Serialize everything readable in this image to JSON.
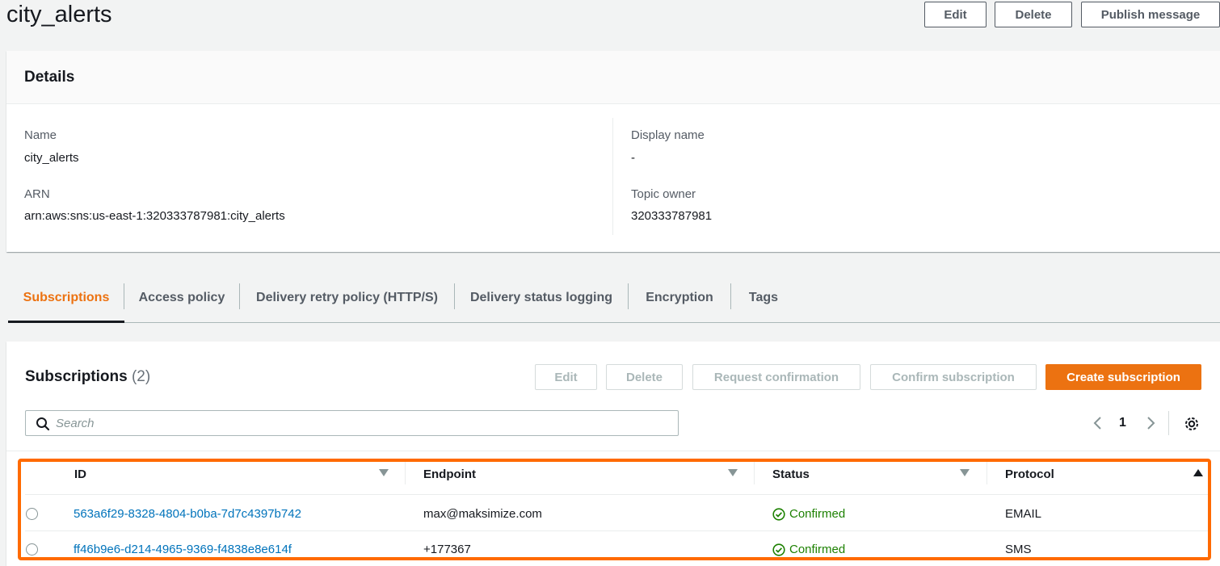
{
  "page": {
    "title": "city_alerts",
    "edit_label": "Edit",
    "delete_label": "Delete",
    "publish_label": "Publish message"
  },
  "details": {
    "heading": "Details",
    "name_label": "Name",
    "name_value": "city_alerts",
    "arn_label": "ARN",
    "arn_value": "arn:aws:sns:us-east-1:320333787981:city_alerts",
    "display_name_label": "Display name",
    "display_name_value": "-",
    "topic_owner_label": "Topic owner",
    "topic_owner_value": "320333787981"
  },
  "tabs": [
    {
      "label": "Subscriptions",
      "active": true
    },
    {
      "label": "Access policy"
    },
    {
      "label": "Delivery retry policy (HTTP/S)"
    },
    {
      "label": "Delivery status logging"
    },
    {
      "label": "Encryption"
    },
    {
      "label": "Tags"
    }
  ],
  "subscriptions": {
    "heading": "Subscriptions",
    "count": "(2)",
    "edit_label": "Edit",
    "delete_label": "Delete",
    "request_confirmation_label": "Request confirmation",
    "confirm_subscription_label": "Confirm subscription",
    "create_subscription_label": "Create subscription",
    "search_placeholder": "Search",
    "page_number": "1",
    "columns": [
      "ID",
      "Endpoint",
      "Status",
      "Protocol"
    ],
    "rows": [
      {
        "id": "563a6f29-8328-4804-b0ba-7d7c4397b742",
        "endpoint": "max@maksimize.com",
        "status": "Confirmed",
        "protocol": "EMAIL"
      },
      {
        "id": "ff46b9e6-d214-4965-9369-f4838e8e614f",
        "endpoint": "+177367‍",
        "status": "Confirmed",
        "protocol": "SMS"
      }
    ]
  },
  "colors": {
    "accent": "#ec7211",
    "link": "#0073bb",
    "success": "#1d8102",
    "highlight": "#ff6a00"
  },
  "icons": [
    "search-icon",
    "chevron-left-icon",
    "chevron-right-icon",
    "gear-icon",
    "sort-down-icon",
    "sort-up-icon",
    "check-circle-icon"
  ]
}
